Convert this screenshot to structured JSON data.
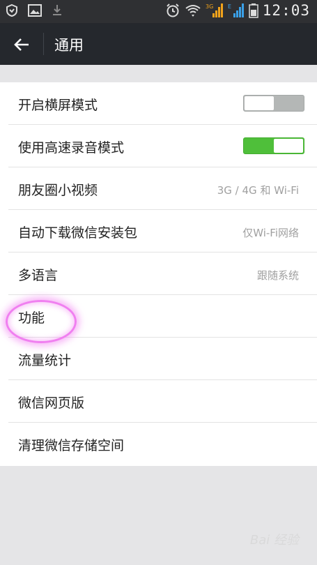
{
  "status_bar": {
    "time": "12:03"
  },
  "header": {
    "title": "通用"
  },
  "settings": [
    {
      "label": "开启横屏模式",
      "type": "toggle",
      "state": "off"
    },
    {
      "label": "使用高速录音模式",
      "type": "toggle",
      "state": "on"
    },
    {
      "label": "朋友圈小视频",
      "type": "value",
      "value": "3G / 4G 和 Wi-Fi"
    },
    {
      "label": "自动下载微信安装包",
      "type": "value",
      "value": "仅Wi-Fi网络"
    },
    {
      "label": "多语言",
      "type": "value",
      "value": "跟随系统"
    },
    {
      "label": "功能",
      "type": "plain"
    },
    {
      "label": "流量统计",
      "type": "plain"
    },
    {
      "label": "微信网页版",
      "type": "plain"
    },
    {
      "label": "清理微信存储空间",
      "type": "plain"
    }
  ],
  "watermark": "Bai 经验",
  "colors": {
    "status_bar": "#2f3033",
    "top_bar": "#25282d",
    "toggle_on": "#4fbf3a",
    "toggle_off": "#b4b7b6",
    "highlight": "#f07ff0"
  }
}
